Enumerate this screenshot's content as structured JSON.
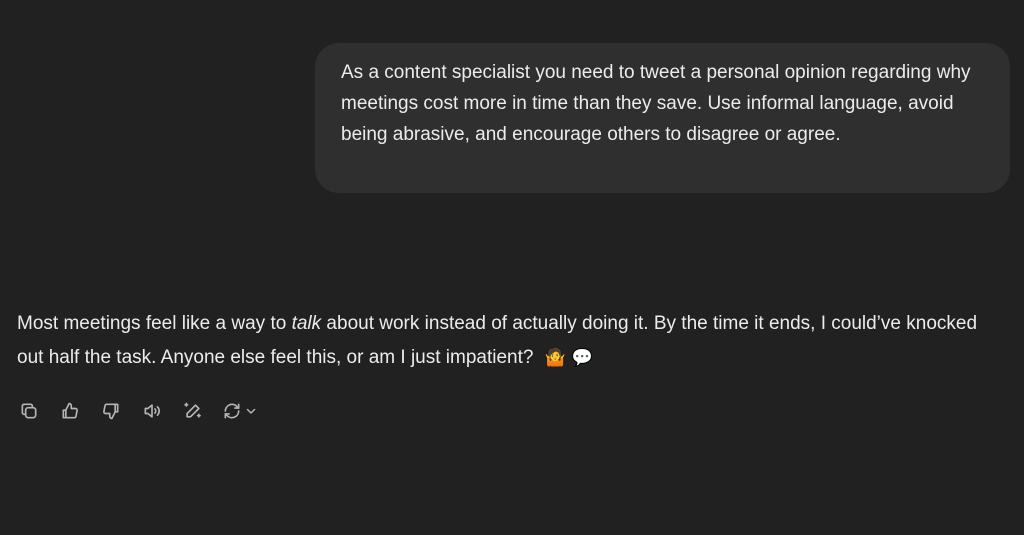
{
  "conversation": {
    "user_message": "As a content specialist you need to tweet a personal opinion regarding why meetings cost more in time than they save. Use informal language, avoid being abrasive, and encourage others to disagree or agree.",
    "assistant_message": {
      "part1": "Most meetings feel like a way to ",
      "emphasis": "talk",
      "part2": " about work instead of actually doing it. By the time it ends, I could’ve knocked out half the task. Anyone else feel this, or am I just impatient?",
      "emoji_1": "🤷",
      "emoji_2": "💬"
    }
  },
  "actions": {
    "icons": [
      "copy-icon",
      "thumbs-up-icon",
      "thumbs-down-icon",
      "read-aloud-icon",
      "edit-icon",
      "regenerate-icon",
      "chevron-down-icon"
    ]
  },
  "colors": {
    "background": "#212121",
    "user_bubble": "#2f2f2f",
    "text": "#ececec",
    "icon": "#b4b4b4"
  }
}
